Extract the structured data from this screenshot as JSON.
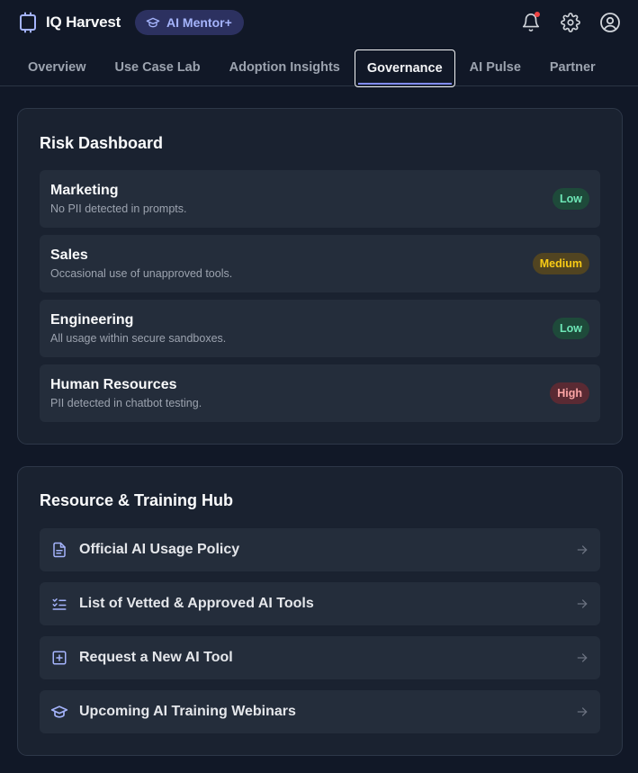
{
  "app": {
    "title": "IQ Harvest",
    "badge": "AI Mentor+"
  },
  "tabs": [
    {
      "label": "Overview",
      "active": false
    },
    {
      "label": "Use Case Lab",
      "active": false
    },
    {
      "label": "Adoption Insights",
      "active": false
    },
    {
      "label": "Governance",
      "active": true
    },
    {
      "label": "AI Pulse",
      "active": false
    },
    {
      "label": "Partner",
      "active": false
    }
  ],
  "risk": {
    "title": "Risk Dashboard",
    "rows": [
      {
        "name": "Marketing",
        "desc": "No PII detected in prompts.",
        "level": "Low"
      },
      {
        "name": "Sales",
        "desc": "Occasional use of unapproved tools.",
        "level": "Medium"
      },
      {
        "name": "Engineering",
        "desc": "All usage within secure sandboxes.",
        "level": "Low"
      },
      {
        "name": "Human Resources",
        "desc": "PII detected in chatbot testing.",
        "level": "High"
      }
    ]
  },
  "resources": {
    "title": "Resource & Training Hub",
    "items": [
      {
        "label": "Official AI Usage Policy",
        "icon": "document-icon"
      },
      {
        "label": "List of Vetted & Approved AI Tools",
        "icon": "checklist-icon"
      },
      {
        "label": "Request a New AI Tool",
        "icon": "plus-square-icon"
      },
      {
        "label": "Upcoming AI Training Webinars",
        "icon": "graduation-cap-icon"
      }
    ]
  },
  "colors": {
    "accent": "#818cf8",
    "background": "#111827",
    "card": "#1a2230",
    "low": "#6ee7b7",
    "medium": "#facc15",
    "high": "#fca5a5"
  }
}
